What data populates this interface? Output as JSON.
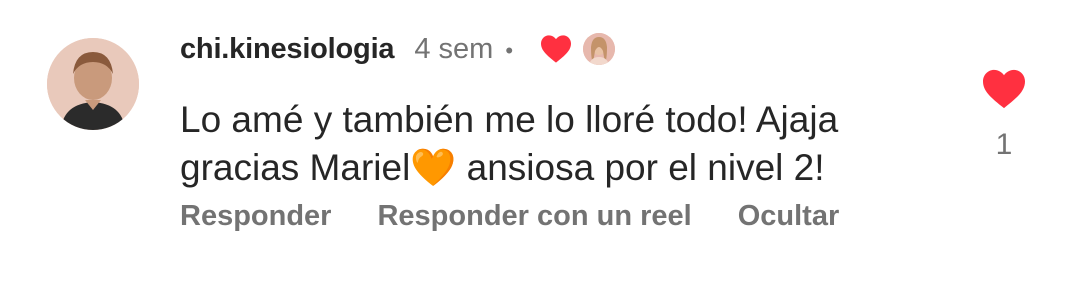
{
  "comment": {
    "username": "chi.kinesiologia",
    "timestamp": "4 sem",
    "separator": "•",
    "text": "Lo amé y también me lo lloré todo! Ajaja\ngracias Mariel🧡 ansiosa por el nivel 2!",
    "creator_liked": true,
    "like_count": "1",
    "actions": {
      "reply": "Responder",
      "reply_reel": "Responder con un reel",
      "hide": "Ocultar"
    }
  },
  "colors": {
    "heart": "#ff3040",
    "muted_text": "#737373",
    "primary_text": "#262626"
  },
  "icons": {
    "creator_heart": "heart-icon",
    "like": "heart-filled-icon"
  }
}
